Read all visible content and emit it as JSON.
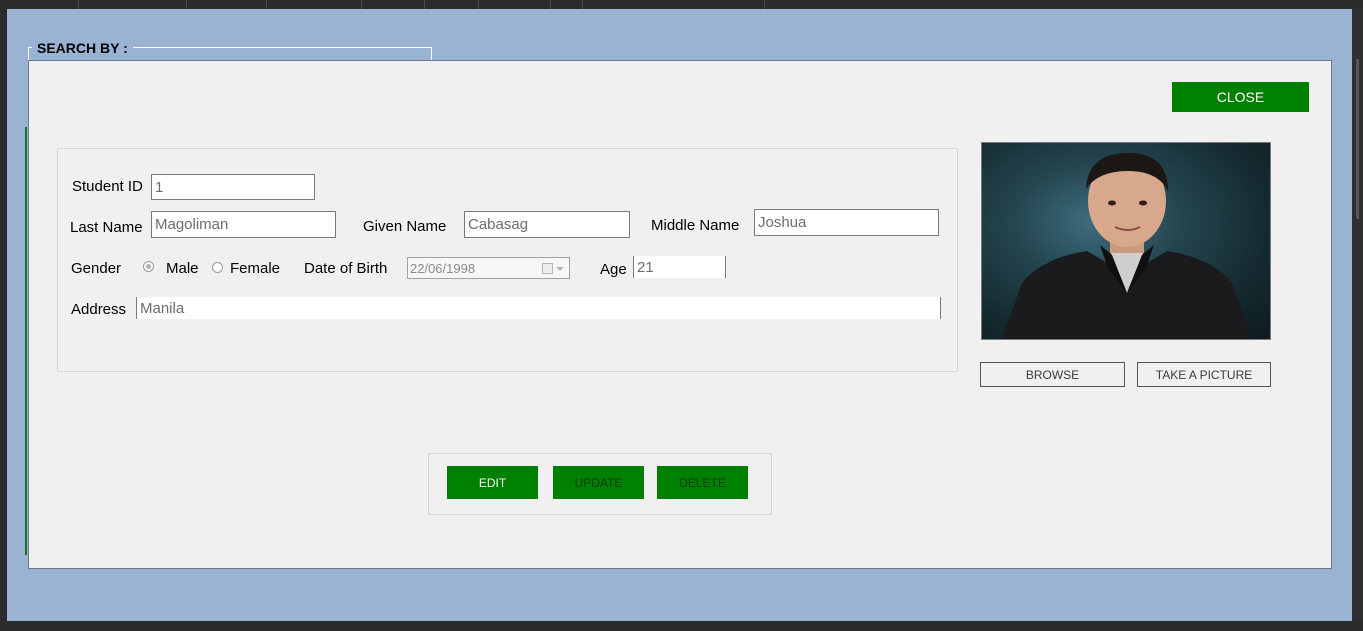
{
  "search_by": {
    "label": "SEARCH BY :"
  },
  "dialog": {
    "close_label": "CLOSE",
    "fields": {
      "student_id": {
        "label": "Student ID",
        "value": "1"
      },
      "last_name": {
        "label": "Last Name",
        "value": "Magoliman"
      },
      "given_name": {
        "label": "Given Name",
        "value": "Cabasag"
      },
      "middle_name": {
        "label": "Middle Name",
        "value": "Joshua"
      },
      "gender": {
        "label": "Gender",
        "options": [
          "Male",
          "Female"
        ],
        "selected": "Male"
      },
      "date_of_birth": {
        "label": "Date of Birth",
        "value": "22/06/1998"
      },
      "age": {
        "label": "Age",
        "value": "21"
      },
      "address": {
        "label": "Address",
        "value": "Manila"
      }
    },
    "photo": {
      "browse_label": "BROWSE",
      "take_picture_label": "TAKE A PICTURE"
    },
    "actions": {
      "edit_label": "EDIT",
      "update_label": "UPDATE",
      "delete_label": "DELETE"
    }
  },
  "colors": {
    "accent_green": "#008000",
    "window_bg": "#9ab3d2",
    "dialog_bg": "#f0f0f0"
  }
}
